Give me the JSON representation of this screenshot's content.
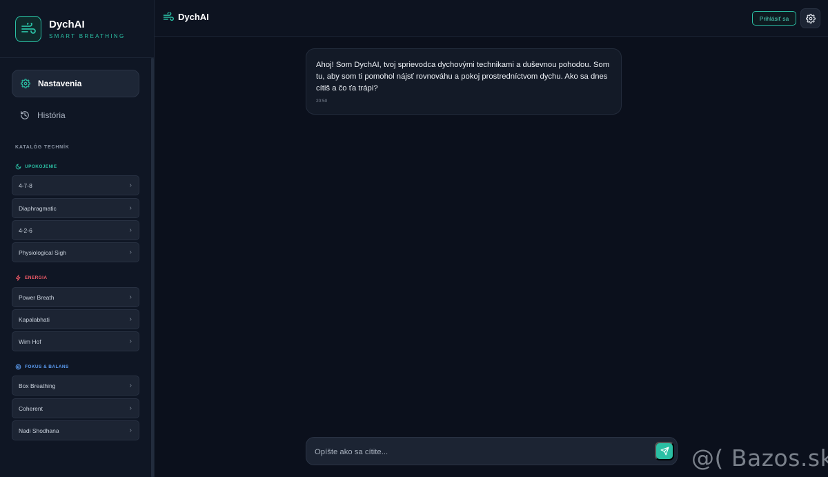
{
  "brand": {
    "name": "DychAI",
    "tagline": "SMART BREATHING"
  },
  "nav": {
    "settings_label": "Nastavenia",
    "history_label": "História"
  },
  "catalog": {
    "title": "KATALÓG TECHNÍK",
    "groups": [
      {
        "label": "UPOKOJENIE",
        "color": "#2bbfa4",
        "icon": "moon-icon",
        "items": [
          "4-7-8",
          "Diaphragmatic",
          "4-2-6",
          "Physiological Sigh"
        ]
      },
      {
        "label": "ENERGIA",
        "color": "#f05a67",
        "icon": "zap-icon",
        "items": [
          "Power Breath",
          "Kapalabhati",
          "Wim Hof"
        ]
      },
      {
        "label": "FOKUS & BALANS",
        "color": "#5b9cf2",
        "icon": "target-icon",
        "items": [
          "Box Breathing",
          "Coherent",
          "Nadi Shodhana"
        ]
      }
    ]
  },
  "header": {
    "title": "DychAI",
    "login_label": "Prihlásiť sa"
  },
  "chat": {
    "messages": [
      {
        "text": "Ahoj! Som DychAI, tvoj sprievodca dychovými technikami a duševnou pohodou. Som tu, aby som ti pomohol nájsť rovnováhu a pokoj prostredníctvom dychu. Ako sa dnes cítiš a čo ťa trápi?",
        "time": "20:50"
      }
    ]
  },
  "composer": {
    "placeholder": "Opíšte ako sa cítite...",
    "value": ""
  },
  "watermark": "@( Bazos.sk",
  "colors": {
    "accent": "#2bbfa4",
    "background": "#0b101c",
    "sidebar": "#0f1624"
  }
}
